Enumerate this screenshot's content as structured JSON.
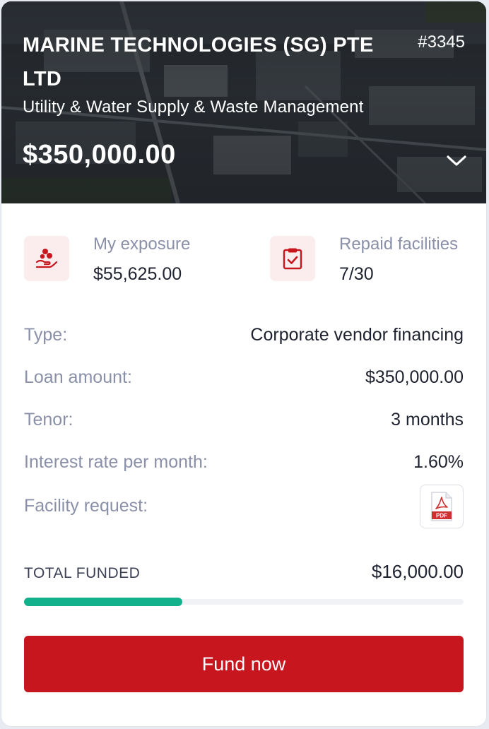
{
  "header": {
    "company_name": "MARINE TECHNOLOGIES (SG) PTE LTD",
    "reference": "#3345",
    "sector": "Utility & Water Supply & Waste Management",
    "amount": "$350,000.00"
  },
  "stats": [
    {
      "label": "My exposure",
      "value": "$55,625.00",
      "icon": "hand-coins-icon"
    },
    {
      "label": "Repaid facilities",
      "value": "7/30",
      "icon": "clipboard-check-icon"
    }
  ],
  "details": {
    "type": {
      "label": "Type:",
      "value": "Corporate vendor financing"
    },
    "loan_amount": {
      "label": "Loan amount:",
      "value": "$350,000.00"
    },
    "tenor": {
      "label": "Tenor:",
      "value": "3 months"
    },
    "interest_rate": {
      "label": "Interest rate per month:",
      "value": "1.60%"
    },
    "facility_request": {
      "label": "Facility request:",
      "icon": "pdf-file-icon",
      "icon_text": "PDF"
    }
  },
  "funding": {
    "label": "TOTAL FUNDED",
    "value": "$16,000.00",
    "progress_fraction": 0.36
  },
  "actions": {
    "fund_now": "Fund now"
  },
  "colors": {
    "accent": "#c8161e",
    "progress": "#13b18b",
    "icon_bg": "#fbeced",
    "muted_text": "#8a90a8"
  }
}
